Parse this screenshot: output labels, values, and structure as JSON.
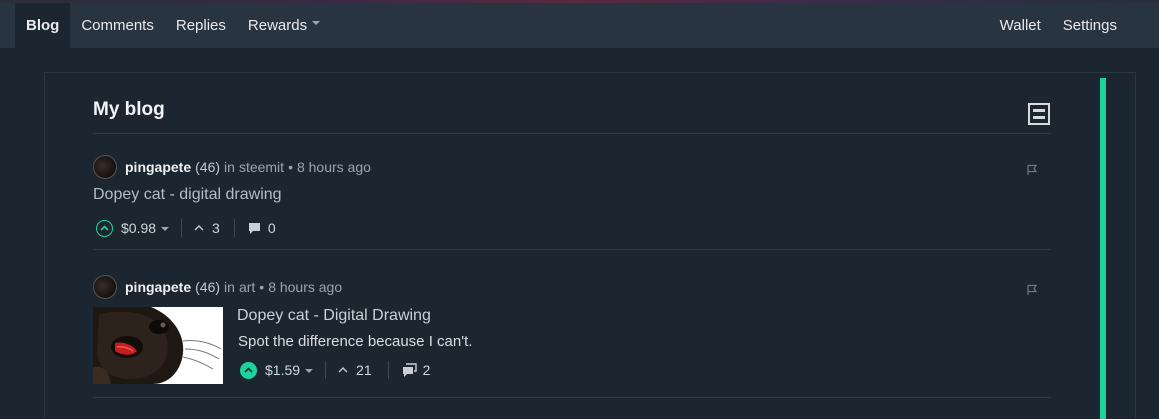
{
  "nav": {
    "left": [
      {
        "label": "Blog",
        "active": true
      },
      {
        "label": "Comments"
      },
      {
        "label": "Replies"
      },
      {
        "label": "Rewards",
        "dropdown": true
      }
    ],
    "right": [
      {
        "label": "Wallet"
      },
      {
        "label": "Settings"
      }
    ]
  },
  "panel": {
    "title": "My blog",
    "toggle_icon": "layout-toggle-icon"
  },
  "posts": [
    {
      "author": "pingapete",
      "reputation": "(46)",
      "in_text": "in",
      "community": "steemit",
      "dot": "•",
      "time": "8 hours ago",
      "title": "Dopey cat - digital drawing",
      "payout": "$0.98",
      "votes": "3",
      "replies": "0",
      "upvoted": false
    },
    {
      "author": "pingapete",
      "reputation": "(46)",
      "in_text": "in",
      "community": "art",
      "dot": "•",
      "time": "8 hours ago",
      "title": "Dopey cat - Digital Drawing",
      "summary": "Spot the difference because I can't.",
      "payout": "$1.59",
      "votes": "21",
      "replies": "2",
      "upvoted": true
    }
  ],
  "colors": {
    "accent": "#1ed39b",
    "background": "#1c2631",
    "topbar": "#283541"
  }
}
